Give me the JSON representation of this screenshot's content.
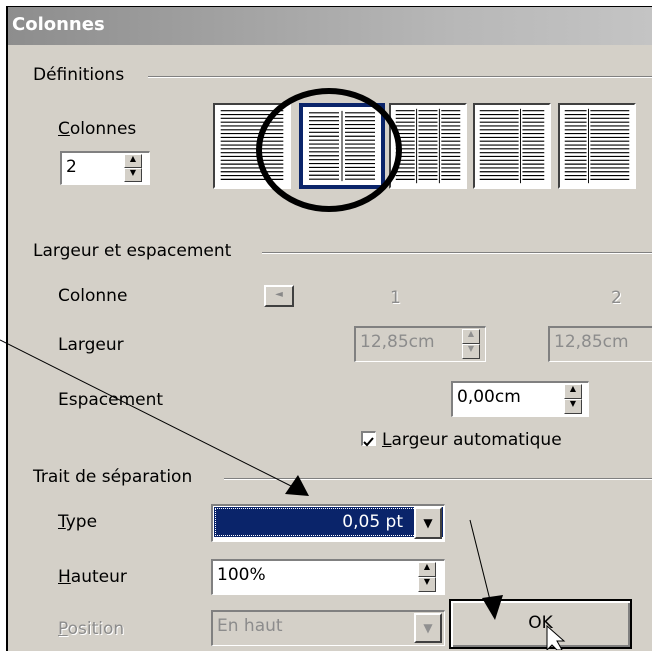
{
  "dialog": {
    "title": "Colonnes",
    "definitions": {
      "group_label": "Définitions",
      "columns_label_mnemonic": "C",
      "columns_label_rest": "olonnes",
      "columns_value": "2",
      "presets": [
        {
          "name": "one-column",
          "columns": 1,
          "selected": false
        },
        {
          "name": "two-columns",
          "columns": 2,
          "selected": true
        },
        {
          "name": "three-columns",
          "columns": 3,
          "selected": false
        },
        {
          "name": "two-columns-left-wide",
          "columns": 2,
          "selected": false
        },
        {
          "name": "two-columns-right-wide",
          "columns": 2,
          "selected": false
        }
      ]
    },
    "width_spacing": {
      "group_label": "Largeur et espacement",
      "column_label": "Colonne",
      "col1": "1",
      "col2": "2",
      "width_label": "Largeur",
      "width1": "12,85cm",
      "width2": "12,85cm",
      "spacing_label": "Espacement",
      "spacing_value": "0,00cm",
      "auto_width_mnemonic": "L",
      "auto_width_rest": "argeur automatique",
      "auto_width_checked": true
    },
    "separator": {
      "group_label": "Trait de séparation",
      "type_mnemonic": "T",
      "type_rest": "ype",
      "type_value": "0,05 pt",
      "height_mnemonic": "H",
      "height_rest": "auteur",
      "height_value": "100%",
      "position_mnemonic": "P",
      "position_rest": "osition",
      "position_value": "En haut"
    },
    "ok_label": "OK"
  },
  "colors": {
    "dialog_bg": "#d4d0c8",
    "selection": "#0a246a",
    "annotation": "#000000"
  }
}
